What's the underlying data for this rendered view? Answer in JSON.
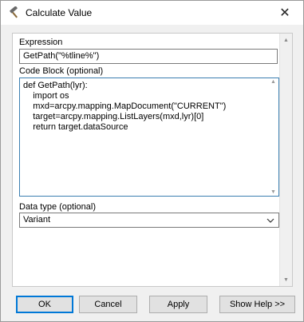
{
  "window": {
    "title": "Calculate Value",
    "close_glyph": "✕",
    "icon": "hammer-icon"
  },
  "form": {
    "expression": {
      "label": "Expression",
      "value": "GetPath(\"%tline%\")"
    },
    "code_block": {
      "label": "Code Block (optional)",
      "lines": [
        "def GetPath(lyr):",
        "    import os",
        "    mxd=arcpy.mapping.MapDocument(\"CURRENT\")",
        "    target=arcpy.mapping.ListLayers(mxd,lyr)[0]",
        "    return target.dataSource"
      ]
    },
    "data_type": {
      "label": "Data type (optional)",
      "value": "Variant"
    }
  },
  "buttons": {
    "ok": "OK",
    "cancel": "Cancel",
    "apply": "Apply",
    "show_help": "Show Help >>"
  }
}
